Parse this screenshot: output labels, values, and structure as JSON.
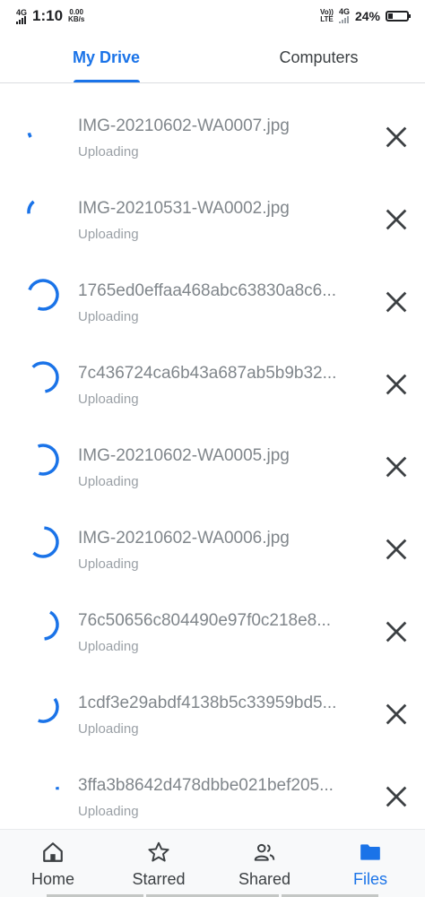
{
  "status_bar": {
    "network_left": "4G",
    "time": "1:10",
    "speed_value": "0.00",
    "speed_unit": "KB/s",
    "volte_top": "Vo))",
    "volte_bottom": "LTE",
    "network_right": "4G",
    "battery": "24%"
  },
  "tabs": [
    {
      "label": "My Drive",
      "active": true
    },
    {
      "label": "Computers",
      "active": false
    }
  ],
  "uploads": [
    {
      "name": "IMG-20210602-WA0007.jpg",
      "status": "Uploading",
      "progress": 0.05
    },
    {
      "name": "IMG-20210531-WA0002.jpg",
      "status": "Uploading",
      "progress": 0.15
    },
    {
      "name": "1765ed0effaa468abc63830a8c6...",
      "status": "Uploading",
      "progress": 0.75
    },
    {
      "name": "7c436724ca6b43a687ab5b9b32...",
      "status": "Uploading",
      "progress": 0.6
    },
    {
      "name": "IMG-20210602-WA0005.jpg",
      "status": "Uploading",
      "progress": 0.6
    },
    {
      "name": "IMG-20210602-WA0006.jpg",
      "status": "Uploading",
      "progress": 0.6
    },
    {
      "name": "76c50656c804490e97f0c218e8...",
      "status": "Uploading",
      "progress": 0.4
    },
    {
      "name": "1cdf3e29abdf4138b5c33959bd5...",
      "status": "Uploading",
      "progress": 0.4
    },
    {
      "name": "3ffa3b8642d478dbbe021bef205...",
      "status": "Uploading",
      "progress": 0.03
    }
  ],
  "bottom_nav": [
    {
      "label": "Home",
      "icon": "home-icon",
      "active": false
    },
    {
      "label": "Starred",
      "icon": "star-icon",
      "active": false
    },
    {
      "label": "Shared",
      "icon": "people-icon",
      "active": false
    },
    {
      "label": "Files",
      "icon": "folder-icon",
      "active": true
    }
  ],
  "colors": {
    "accent": "#1a73e8",
    "text_muted": "#80868b"
  }
}
